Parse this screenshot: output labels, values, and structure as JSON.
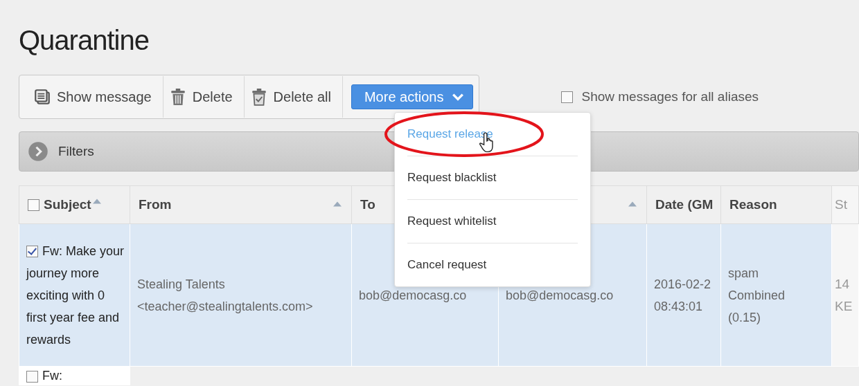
{
  "title": "Quarantine",
  "toolbar": {
    "buttons": [
      {
        "label": "Show message",
        "kind": "message"
      },
      {
        "label": "Delete",
        "kind": "trash"
      },
      {
        "label": "Delete all",
        "kind": "trash-all"
      }
    ],
    "more": {
      "label": "More actions",
      "expanded": true
    }
  },
  "alias_option": {
    "label": "Show messages for all aliases",
    "checked": false
  },
  "filters": {
    "label": "Filters"
  },
  "menu": [
    {
      "label": "Request release",
      "selected": true
    },
    {
      "label": "Request blacklist",
      "selected": false
    },
    {
      "label": "Request whitelist",
      "selected": false
    },
    {
      "label": "Cancel request",
      "selected": false
    }
  ],
  "table": {
    "columns": [
      {
        "label": "Subject",
        "sort_arrow": true,
        "faded": false
      },
      {
        "label": "From",
        "sort_arrow": true,
        "faded": false
      },
      {
        "label": "To",
        "faded": false
      },
      {
        "sort_arrow": true,
        "faded": false
      },
      {
        "label": "Date (GM",
        "sort_arrow": false,
        "faded": false
      },
      {
        "label": "Reason",
        "sort_arrow": false,
        "faded": false
      },
      {
        "label": "St",
        "sort_arrow": false,
        "faded": true
      }
    ],
    "all_checked": false,
    "rows": [
      {
        "selected": true,
        "checked": true,
        "cells": [
          [
            "Fw: Make your journey more exciting with 0 first year fee and rewards"
          ],
          [
            "Stealing Talents",
            "<teacher@stealingtalents.com>"
          ],
          [
            "bob@democasg.co"
          ],
          [
            "bob@democasg.co"
          ],
          [
            "2016-02-2",
            "08:43:01"
          ],
          [
            "spam",
            "Combined",
            "(0.15)"
          ],
          [
            "14",
            "KE"
          ]
        ]
      },
      {
        "selected": false,
        "checked": false,
        "cells": [
          [
            "Fw:"
          ]
        ]
      }
    ]
  }
}
